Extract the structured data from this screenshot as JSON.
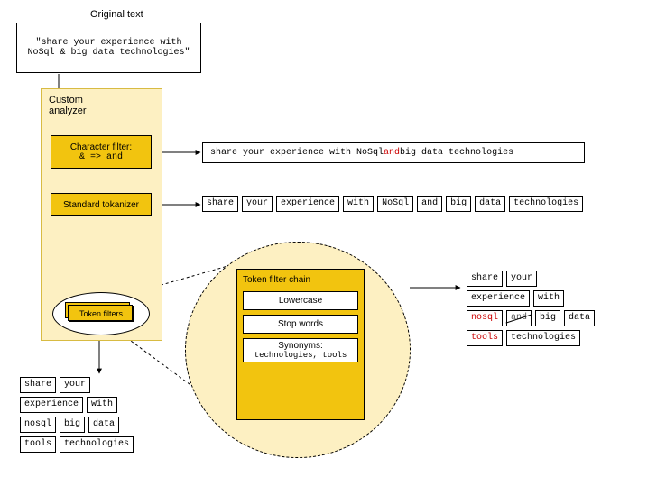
{
  "titles": {
    "original_text": "Original text",
    "custom_analyzer": "Custom analyzer",
    "char_filter_l1": "Character filter:",
    "char_filter_l2": "& => and",
    "tokenizer": "Standard tokanizer",
    "token_filters": "Token filters",
    "filter_chain_title": "Token filter chain",
    "filter_lowercase": "Lowercase",
    "filter_stopwords": "Stop words",
    "filter_synonyms_l1": "Synonyms:",
    "filter_synonyms_l2": "technologies, tools"
  },
  "original_quote": "\"share your experience with NoSql & big data technologies\"",
  "after_charfilter_prefix": "share your experience with NoSql ",
  "after_charfilter_mid": "and",
  "after_charfilter_suffix": " big data technologies",
  "tokens_after_tokenizer": [
    "share",
    "your",
    "experience",
    "with",
    "NoSql",
    "and",
    "big",
    "data",
    "technologies"
  ],
  "tokens_mid": {
    "row1": [
      "share",
      "your"
    ],
    "row2": [
      "experience",
      "with"
    ],
    "row3_red": "nosql",
    "row3_strike": "and",
    "row3_rest": [
      "big",
      "data"
    ],
    "row4_red": "tools",
    "row4_rest": [
      "technologies"
    ]
  },
  "tokens_final": {
    "row1": [
      "share",
      "your"
    ],
    "row2": [
      "experience",
      "with"
    ],
    "row3": [
      "nosql",
      "big",
      "data"
    ],
    "row4": [
      "tools",
      "technologies"
    ]
  }
}
